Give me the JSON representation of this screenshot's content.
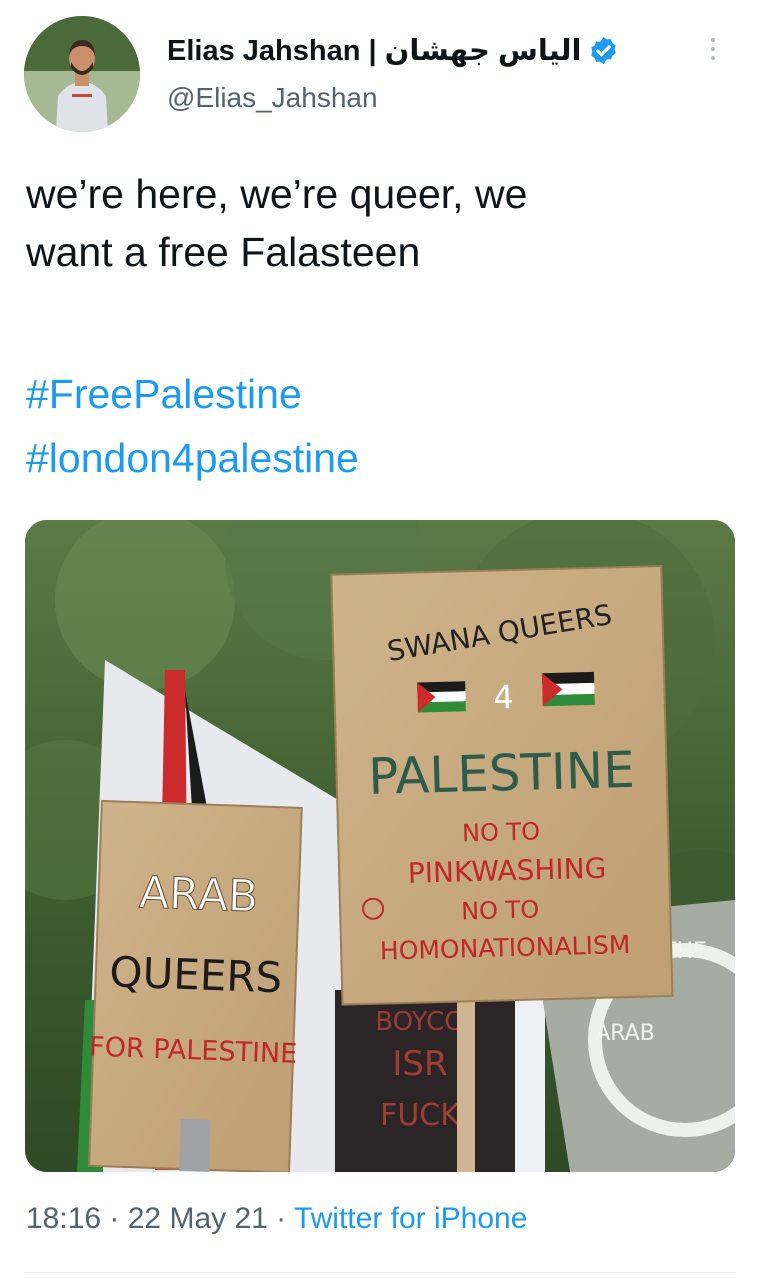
{
  "tweet": {
    "author": {
      "display_name": "Elias Jahshan | الياس جهشان",
      "handle": "@Elias_Jahshan",
      "verified": true,
      "avatar_icon": "profile-photo"
    },
    "text_lines": [
      "we’re here, we’re queer, we",
      "want a free Falasteen"
    ],
    "hashtags": [
      "#FreePalestine",
      "#london4palestine"
    ],
    "media": {
      "description_icon": "protest-photo",
      "signs": {
        "center": [
          "SWANA QUEERS",
          "4",
          "PALESTINE",
          "NO TO",
          "PINKWASHING",
          "NO TO",
          "HOMONATIONALISM"
        ],
        "left": [
          "ARAB",
          "QUEERS",
          "FOR PALESTINE"
        ],
        "back": [
          "BOYCO",
          "ISR",
          "FUCK"
        ],
        "right": [
          "THE",
          "ARAB"
        ]
      }
    },
    "meta": {
      "time": "18:16",
      "separator": " · ",
      "date": "22 May 21",
      "source": "Twitter for iPhone"
    }
  },
  "colors": {
    "link": "#1d9bf0",
    "secondary_text": "#536471",
    "verified_badge": "#1d9bf0"
  }
}
